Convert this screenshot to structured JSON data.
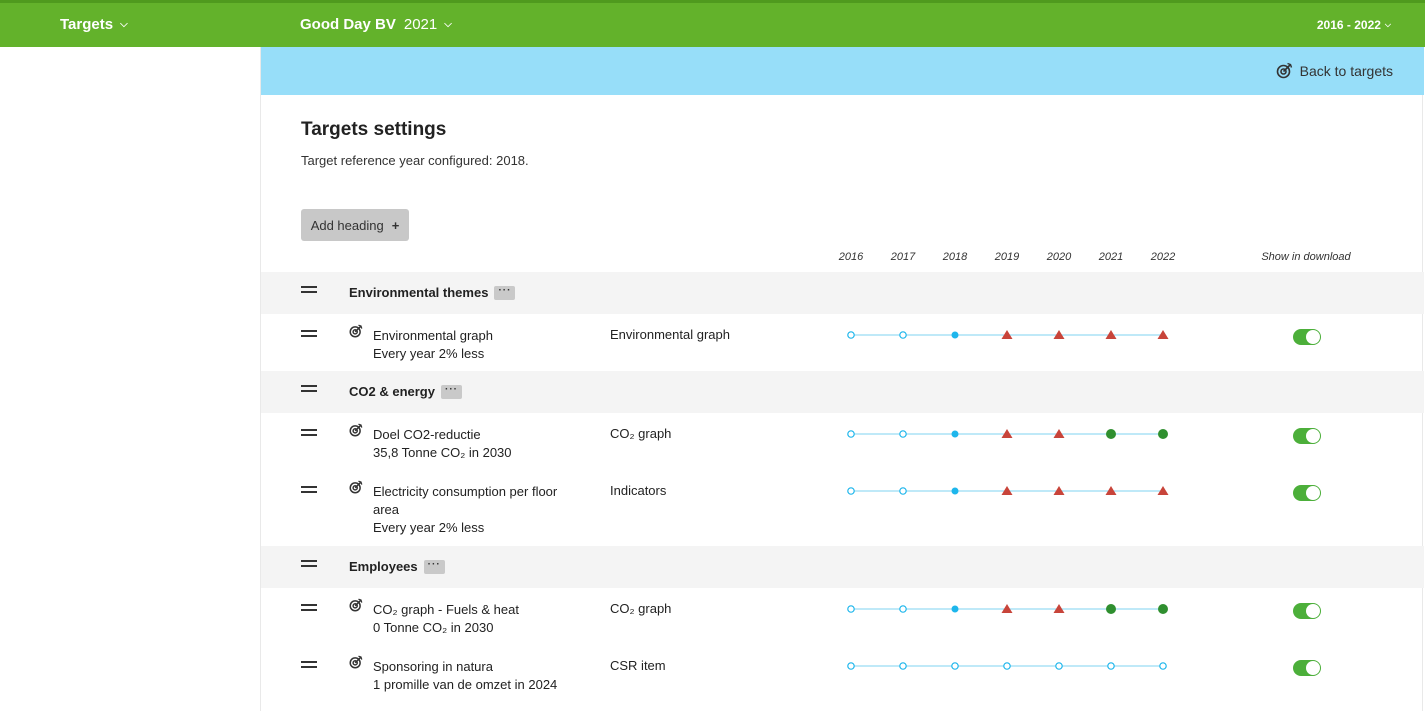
{
  "nav": {
    "targets": "Targets",
    "company": "Good Day BV",
    "year": "2021",
    "range": "2016 - 2022"
  },
  "back": "Back to targets",
  "page": {
    "title": "Targets settings",
    "ref_year": "Target reference year configured: 2018."
  },
  "add_heading": "Add heading",
  "years": [
    "2016",
    "2017",
    "2018",
    "2019",
    "2020",
    "2021",
    "2022"
  ],
  "show_in_download": "Show in download",
  "colors": {
    "accent": "#63b22b",
    "blue": "#1db6ec",
    "red": "#c8443a",
    "green": "#2f8f2f"
  },
  "groups": [
    {
      "title": "Environmental themes",
      "targets": [
        {
          "name": "Environmental graph",
          "desc": "Every year 2% less",
          "graph": "Environmental graph",
          "status": [
            "open",
            "open",
            "filled",
            "red",
            "red",
            "red",
            "red"
          ],
          "show": true
        }
      ]
    },
    {
      "title": "CO2 & energy",
      "targets": [
        {
          "name": "Doel CO2-reductie",
          "desc": "35,8 Tonne CO₂ in 2030",
          "graph": "CO₂ graph",
          "status": [
            "open",
            "open",
            "filled",
            "red",
            "red",
            "green",
            "green"
          ],
          "show": true
        },
        {
          "name": "Electricity consumption per floor area",
          "desc": "Every year 2% less",
          "graph": "Indicators",
          "status": [
            "open",
            "open",
            "filled",
            "red",
            "red",
            "red",
            "red"
          ],
          "show": true
        }
      ]
    },
    {
      "title": "Employees",
      "targets": [
        {
          "name": "CO₂ graph - Fuels & heat",
          "desc": "0 Tonne CO₂ in 2030",
          "graph": "CO₂ graph",
          "status": [
            "open",
            "open",
            "filled",
            "red",
            "red",
            "green",
            "green"
          ],
          "show": true
        },
        {
          "name": "Sponsoring in natura",
          "desc": "1 promille van de omzet in 2024",
          "graph": "CSR item",
          "status": [
            "open",
            "open",
            "open",
            "open",
            "open",
            "open",
            "open"
          ],
          "show": true
        }
      ]
    }
  ]
}
